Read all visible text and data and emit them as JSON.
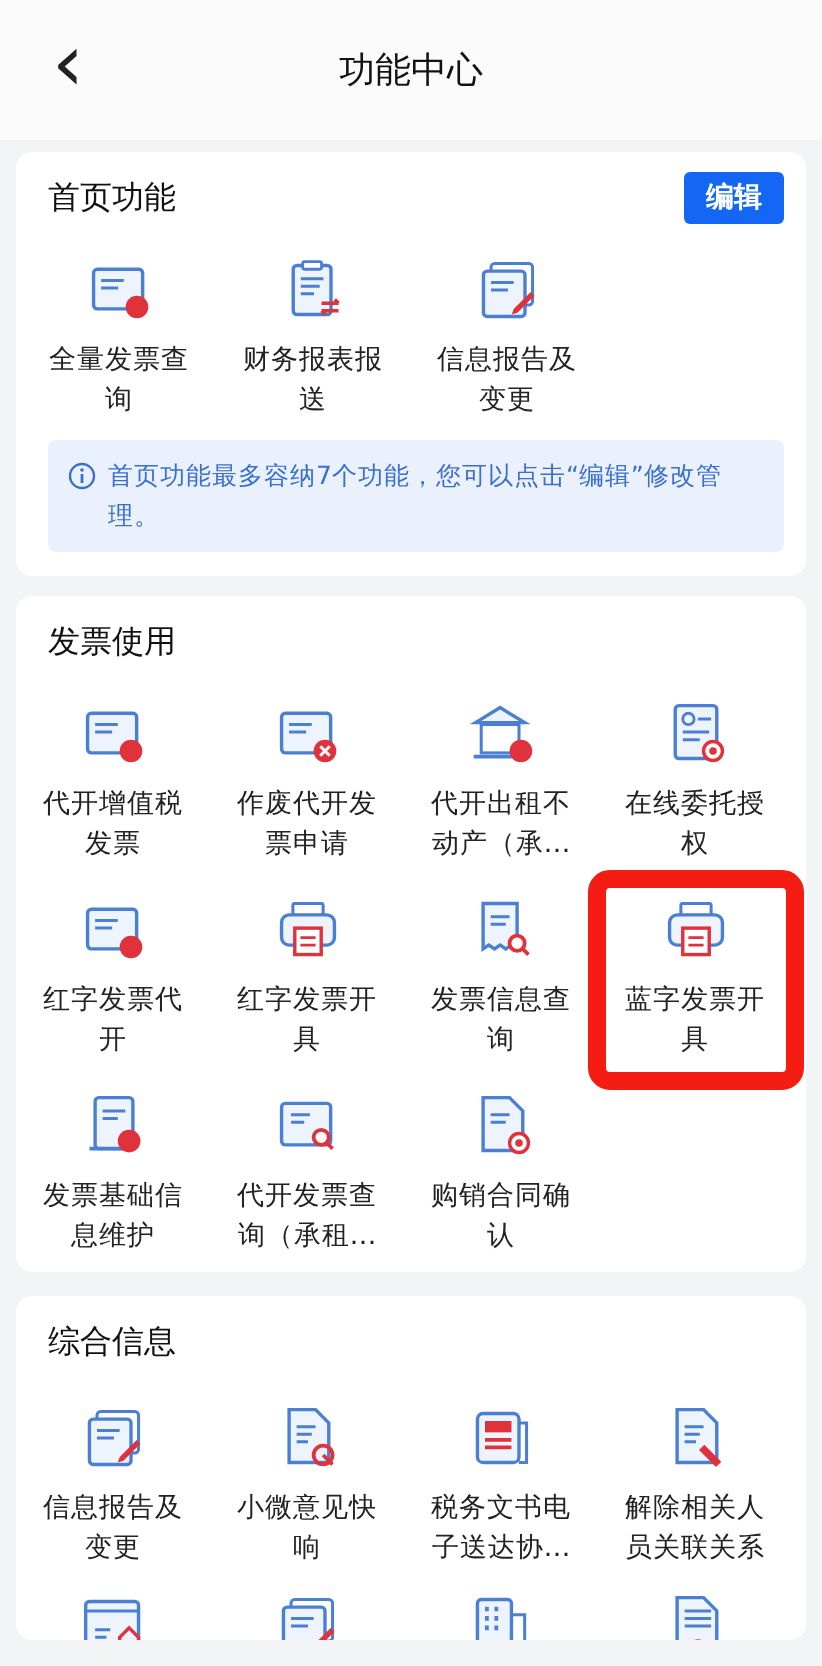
{
  "header": {
    "back": "‹",
    "title": "功能中心"
  },
  "sections": [
    {
      "title": "首页功能",
      "edit_button": "编辑",
      "info": "首页功能最多容纳7个功能，您可以点击“编辑”修改管理。",
      "items": [
        {
          "kind": "function",
          "label": "全量发票查询",
          "highlighted": false
        },
        {
          "kind": "function",
          "label": "财务报表报送",
          "highlighted": false
        },
        {
          "kind": "function",
          "label": "信息报告及变更",
          "highlighted": false
        }
      ]
    },
    {
      "title": "发票使用",
      "items": [
        {
          "kind": "function",
          "label": "代开增值税发票",
          "highlighted": false
        },
        {
          "kind": "function",
          "label": "作废代开发票申请",
          "highlighted": false
        },
        {
          "kind": "function",
          "label": "代开出租不动产（承…",
          "highlighted": false
        },
        {
          "kind": "function",
          "label": "在线委托授权",
          "highlighted": false
        },
        {
          "kind": "function",
          "label": "红字发票代开",
          "highlighted": false
        },
        {
          "kind": "function",
          "label": "红字发票开具",
          "highlighted": false
        },
        {
          "kind": "function",
          "label": "发票信息查询",
          "highlighted": false
        },
        {
          "kind": "function",
          "label": "蓝字发票开具",
          "highlighted": true
        },
        {
          "kind": "function",
          "label": "发票基础信息维护",
          "highlighted": false
        },
        {
          "kind": "function",
          "label": "代开发票查询（承租…",
          "highlighted": false
        },
        {
          "kind": "function",
          "label": "购销合同确认",
          "highlighted": false
        }
      ]
    },
    {
      "title": "综合信息",
      "items": [
        {
          "kind": "function",
          "label": "信息报告及变更",
          "highlighted": false
        },
        {
          "kind": "function",
          "label": "小微意见快响",
          "highlighted": false
        },
        {
          "kind": "function",
          "label": "税务文书电子送达协…",
          "highlighted": false
        },
        {
          "kind": "function",
          "label": "解除相关人员关联关系",
          "highlighted": false
        },
        {
          "kind": "partial"
        },
        {
          "kind": "partial"
        },
        {
          "kind": "partial"
        },
        {
          "kind": "partial"
        }
      ]
    }
  ]
}
